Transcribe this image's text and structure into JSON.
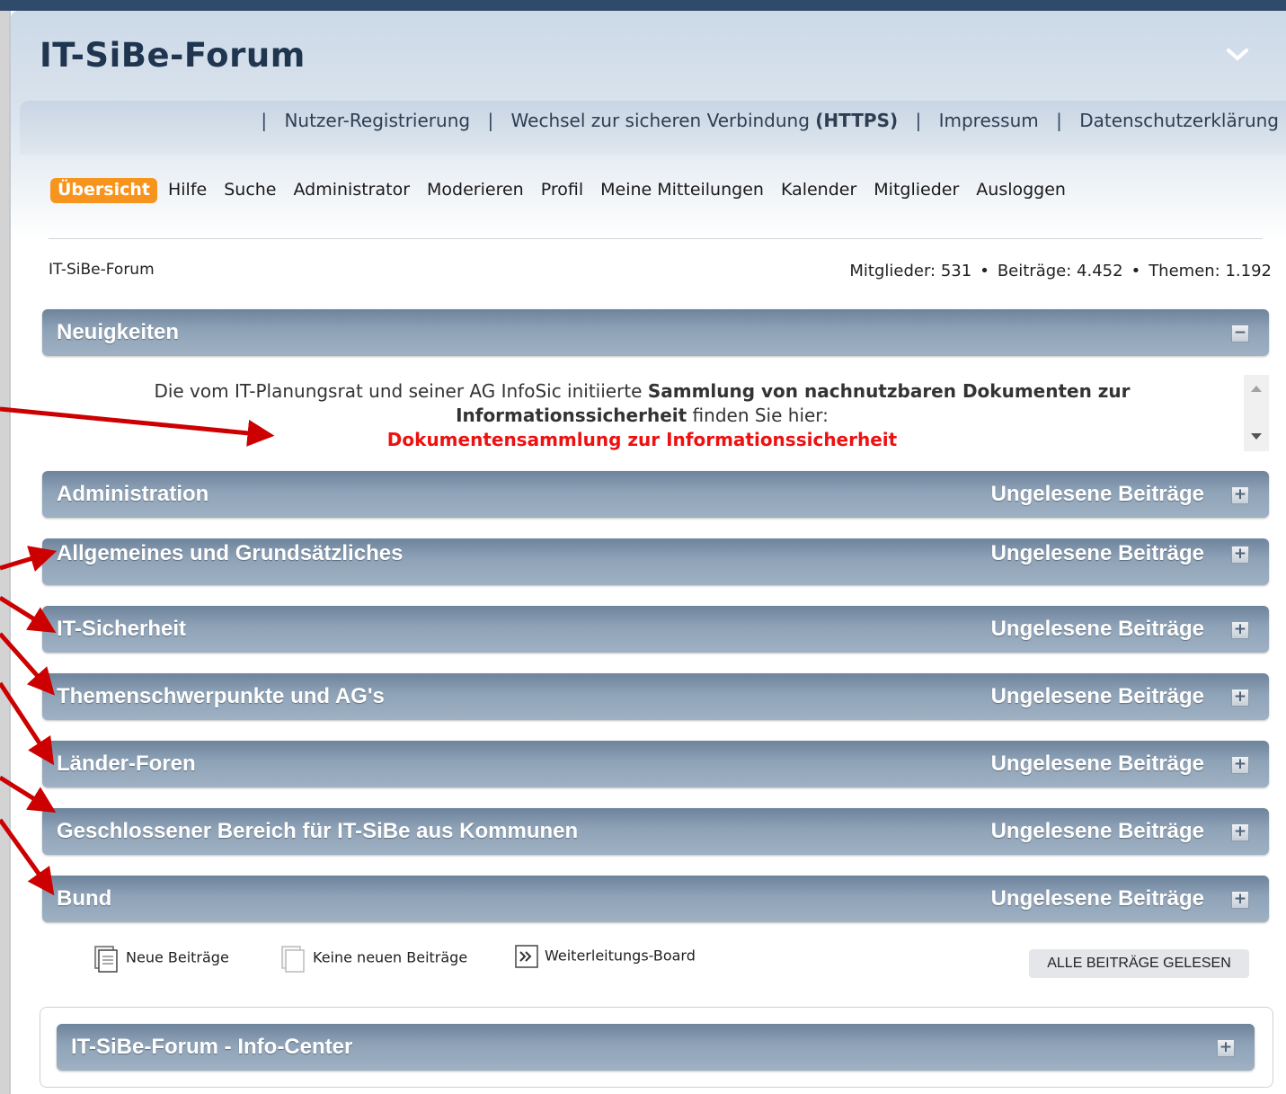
{
  "header": {
    "title": "IT-SiBe-Forum",
    "links": [
      "Nutzer-Registrierung",
      "Wechsel zur sicheren Verbindung",
      "(HTTPS)",
      "Impressum",
      "Datenschutzerklärung"
    ]
  },
  "nav": {
    "items": [
      "Übersicht",
      "Hilfe",
      "Suche",
      "Administrator",
      "Moderieren",
      "Profil",
      "Meine Mitteilungen",
      "Kalender",
      "Mitglieder",
      "Ausloggen"
    ]
  },
  "breadcrumb": "IT-SiBe-Forum",
  "stats": {
    "members": "Mitglieder: 531",
    "posts": "Beiträge: 4.452",
    "topics": "Themen: 1.192"
  },
  "news": {
    "title": "Neuigkeiten",
    "text_pre": "Die vom IT-Planungsrat und seiner AG InfoSic initiierte",
    "text_bold": "Sammlung von nachnutzbaren Dokumenten zur Informationssicherheit",
    "text_post": "finden Sie hier:",
    "link": "Dokumentensammlung zur Informationssicherheit"
  },
  "categories": [
    {
      "title": "Administration",
      "unread": "Ungelesene Beiträge"
    },
    {
      "title": "Allgemeines und Grundsätzliches",
      "unread": "Ungelesene Beiträge"
    },
    {
      "title": "IT-Sicherheit",
      "unread": "Ungelesene Beiträge"
    },
    {
      "title": "Themenschwerpunkte und AG's",
      "unread": "Ungelesene Beiträge"
    },
    {
      "title": "Länder-Foren",
      "unread": "Ungelesene Beiträge"
    },
    {
      "title": "Geschlossener Bereich für IT-SiBe aus Kommunen",
      "unread": "Ungelesene Beiträge"
    },
    {
      "title": "Bund",
      "unread": "Ungelesene Beiträge"
    }
  ],
  "legend": {
    "new": "Neue Beiträge",
    "none": "Keine neuen Beiträge",
    "redirect": "Weiterleitungs-Board"
  },
  "mark_read": "ALLE BEITRÄGE GELESEN",
  "info_center": {
    "title": "IT-SiBe-Forum - Info-Center"
  },
  "toggle": {
    "minus": "−",
    "plus": "+"
  },
  "colors": {
    "accent": "#f7941d",
    "annotation_arrow": "#cc0000",
    "news_link": "#ee1111"
  }
}
